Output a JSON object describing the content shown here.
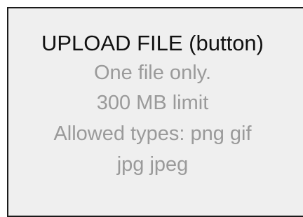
{
  "upload": {
    "button_label": "UPLOAD FILE (button)",
    "limit_text": "One file only.",
    "size_text": "300 MB limit",
    "types_text": "Allowed types: png gif",
    "types_text_cont": "jpg jpeg"
  },
  "colors": {
    "background": "#efefef",
    "border": "#1a1a1a",
    "primary_text": "#111111",
    "secondary_text": "#9a9a9a"
  }
}
